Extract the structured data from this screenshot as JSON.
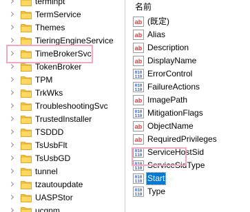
{
  "tree": {
    "items": [
      {
        "label": "terminpt",
        "selected": false
      },
      {
        "label": "TermService",
        "selected": false
      },
      {
        "label": "Themes",
        "selected": false
      },
      {
        "label": "TieringEngineService",
        "selected": false
      },
      {
        "label": "TimeBrokerSvc",
        "selected": true
      },
      {
        "label": "TokenBroker",
        "selected": false
      },
      {
        "label": "TPM",
        "selected": false
      },
      {
        "label": "TrkWks",
        "selected": false
      },
      {
        "label": "TroubleshootingSvc",
        "selected": false
      },
      {
        "label": "TrustedInstaller",
        "selected": false
      },
      {
        "label": "TSDDD",
        "selected": false
      },
      {
        "label": "TsUsbFlt",
        "selected": false
      },
      {
        "label": "TsUsbGD",
        "selected": false
      },
      {
        "label": "tunnel",
        "selected": false
      },
      {
        "label": "tzautoupdate",
        "selected": false
      },
      {
        "label": "UASPStor",
        "selected": false
      },
      {
        "label": "ucgnm",
        "selected": false
      }
    ],
    "item_icon": "folder-icon",
    "expander_icon": "chevron-right-icon",
    "folder_color": "#f3c84a",
    "highlight_color": "#f2a7c4"
  },
  "values": {
    "header": "名前",
    "items": [
      {
        "name": "(既定)",
        "icon": "string-value-icon",
        "selected": false
      },
      {
        "name": "Alias",
        "icon": "string-value-icon",
        "selected": false
      },
      {
        "name": "Description",
        "icon": "string-value-icon",
        "selected": false
      },
      {
        "name": "DisplayName",
        "icon": "string-value-icon",
        "selected": false
      },
      {
        "name": "ErrorControl",
        "icon": "binary-value-icon",
        "selected": false
      },
      {
        "name": "FailureActions",
        "icon": "binary-value-icon",
        "selected": false
      },
      {
        "name": "ImagePath",
        "icon": "string-value-icon",
        "selected": false
      },
      {
        "name": "MitigationFlags",
        "icon": "binary-value-icon",
        "selected": false
      },
      {
        "name": "ObjectName",
        "icon": "string-value-icon",
        "selected": false
      },
      {
        "name": "RequiredPrivileges",
        "icon": "string-value-icon",
        "selected": false
      },
      {
        "name": "ServiceHostSid",
        "icon": "binary-value-icon",
        "selected": false
      },
      {
        "name": "ServiceSidType",
        "icon": "binary-value-icon",
        "selected": false
      },
      {
        "name": "Start",
        "icon": "binary-value-icon",
        "selected": true
      },
      {
        "name": "Type",
        "icon": "binary-value-icon",
        "selected": false
      }
    ],
    "selection_color": "#0078d7",
    "string_icon_color": "#d83b3b",
    "binary_icon_color": "#2e5fbf"
  }
}
